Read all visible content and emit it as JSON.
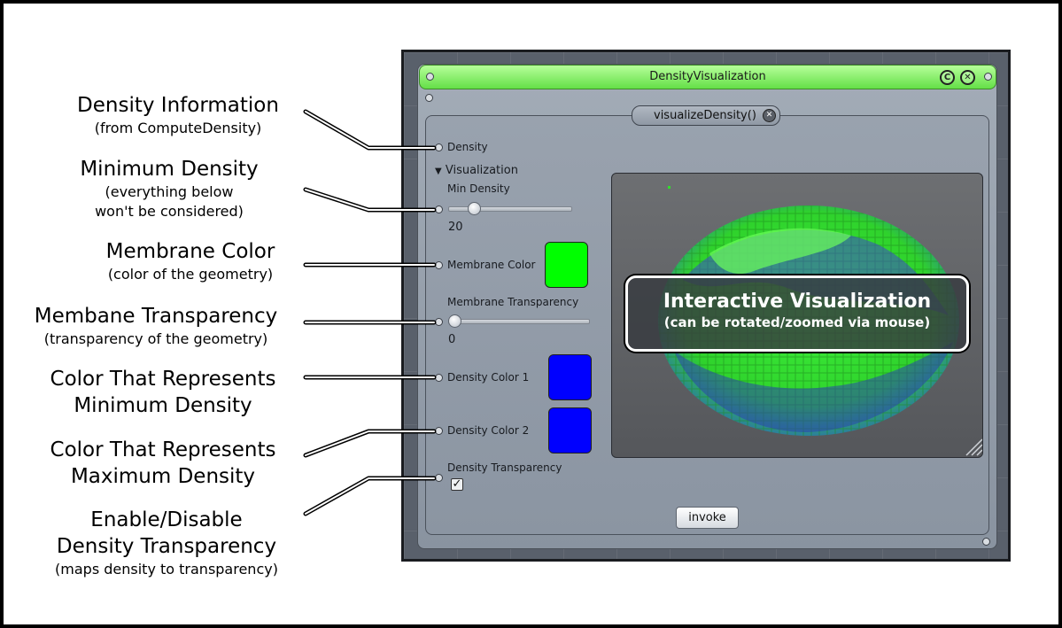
{
  "annotations": [
    {
      "title": "Density Information",
      "subtitle": "(from ComputeDensity)"
    },
    {
      "title": "Minimum Density",
      "subtitle": "(everything below\nwon't be considered)"
    },
    {
      "title": "Membrane Color",
      "subtitle": "(color of the geometry)"
    },
    {
      "title": "Membane Transparency",
      "subtitle": "(transparency of the geometry)"
    },
    {
      "title": "Color That Represents\nMinimum Density",
      "subtitle": ""
    },
    {
      "title": "Color That Represents\nMaximum Density",
      "subtitle": ""
    },
    {
      "title": "Enable/Disable\nDensity Transparency",
      "subtitle": "(maps density to transparency)"
    }
  ],
  "window": {
    "title": "DensityVisualization",
    "close_glyph": "✕",
    "copy_glyph": "C"
  },
  "method": {
    "name": "visualizeDensity()",
    "close_glyph": "✕"
  },
  "fields": {
    "density_label": "Density",
    "section_label": "Visualization",
    "section_toggle_glyph": "▼",
    "min_density_label": "Min Density",
    "min_density_value": "20",
    "min_density_fraction": 0.18,
    "membrane_color_label": "Membrane Color",
    "membrane_color": "#00ff00",
    "membrane_transparency_label": "Membrane Transparency",
    "membrane_transparency_value": "0",
    "membrane_transparency_fraction": 0.0,
    "density_color1_label": "Density Color 1",
    "density_color1": "#0000ff",
    "density_color2_label": "Density Color 2",
    "density_color2": "#0000ff",
    "density_transparency_label": "Density Transparency",
    "density_transparency_checked": true,
    "checkmark_glyph": "✓",
    "invoke_label": "invoke"
  },
  "viewport": {
    "callout_title": "Interactive Visualization",
    "callout_subtitle": "(can be rotated/zoomed via mouse)"
  },
  "colors": {
    "titlebar_green": "#64df47",
    "membrane_green": "#2fe02a",
    "density_blue": "#2233dd"
  }
}
